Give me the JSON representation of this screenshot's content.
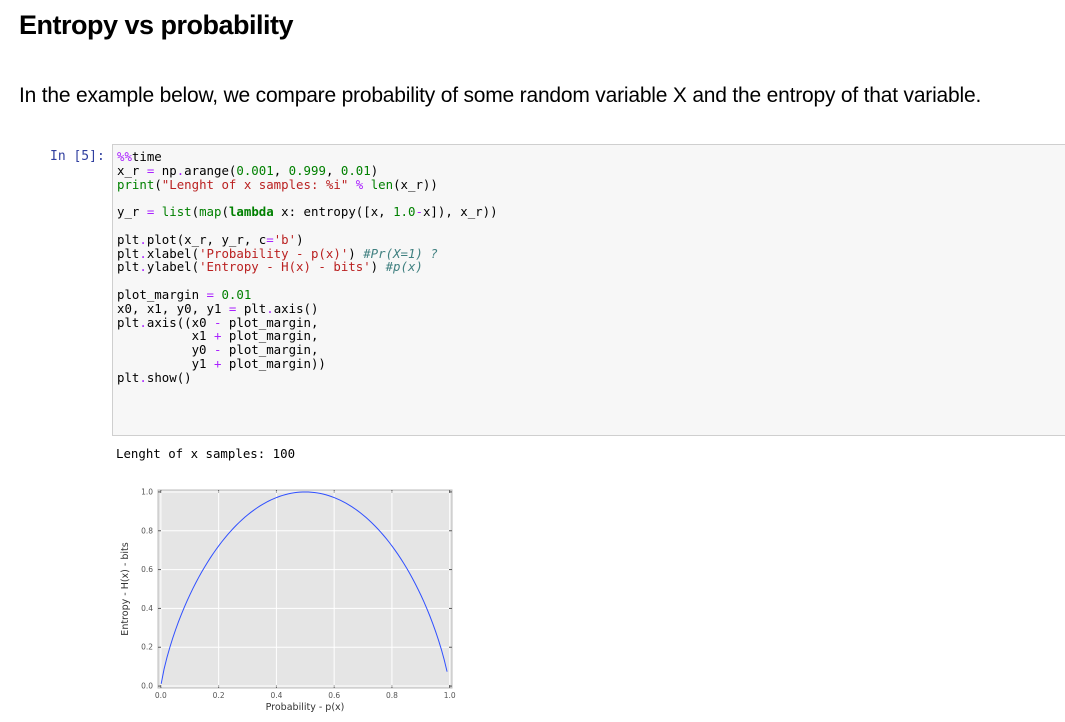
{
  "heading": "Entropy vs probability",
  "intro": "In the example below, we compare probability of some random variable X and the entropy of that variable.",
  "cell": {
    "prompt": "In [5]:",
    "output": "Lenght of x samples: 100"
  },
  "chart_data": {
    "type": "line",
    "xlabel": "Probability - p(x)",
    "ylabel": "Entropy - H(x) - bits",
    "xlim": [
      -0.01,
      1.008
    ],
    "ylim": [
      -0.01,
      1.01
    ],
    "xticks": [
      "0.0",
      "0.2",
      "0.4",
      "0.6",
      "0.8",
      "1.0"
    ],
    "yticks": [
      "0.0",
      "0.2",
      "0.4",
      "0.6",
      "0.8",
      "1.0"
    ],
    "x_range": [
      0.001,
      0.991
    ],
    "x_step": 0.01,
    "function": "binary entropy H(p) = -p log2 p - (1-p) log2 (1-p)",
    "grid": true,
    "background": "#e5e5e5",
    "line_color": "#3050ff",
    "series": [
      {
        "values_sampled": [
          [
            0.0,
            0.011
          ],
          [
            0.1,
            0.469
          ],
          [
            0.2,
            0.722
          ],
          [
            0.3,
            0.881
          ],
          [
            0.4,
            0.971
          ],
          [
            0.5,
            1.0
          ],
          [
            0.6,
            0.971
          ],
          [
            0.7,
            0.881
          ],
          [
            0.8,
            0.722
          ],
          [
            0.9,
            0.469
          ],
          [
            0.991,
            0.074
          ]
        ]
      }
    ]
  }
}
